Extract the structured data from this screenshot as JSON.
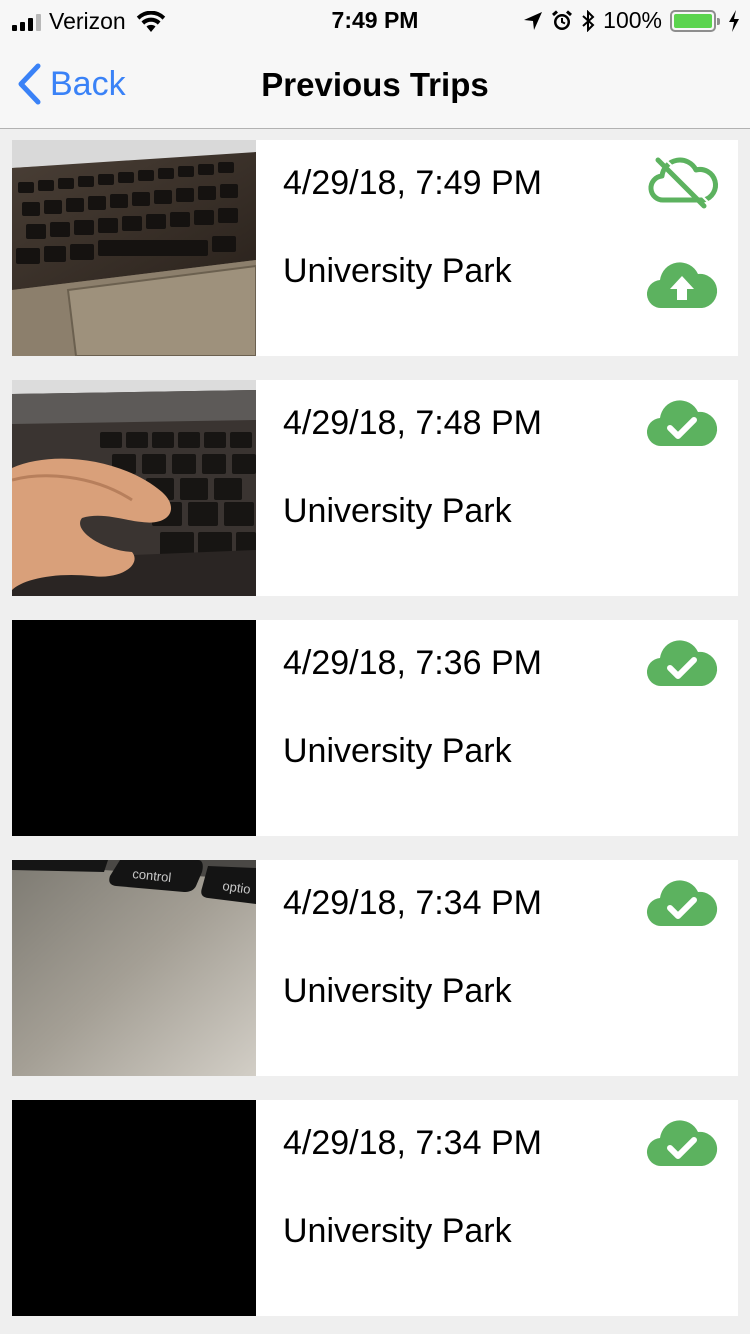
{
  "status_bar": {
    "carrier": "Verizon",
    "time": "7:49 PM",
    "battery_percent": "100%",
    "battery_level": 1.0,
    "signal_bars": 3,
    "icons": [
      "signal-icon",
      "wifi-icon",
      "location-arrow-icon",
      "alarm-icon",
      "bluetooth-icon",
      "battery-icon",
      "charging-bolt-icon"
    ]
  },
  "nav": {
    "back_label": "Back",
    "title": "Previous Trips"
  },
  "colors": {
    "accent": "#3a82f7",
    "cloud_green": "#5cb25f",
    "battery_green": "#5bd44e"
  },
  "trips": [
    {
      "date": "4/29/18, 7:49 PM",
      "place": "University Park",
      "status_icon": "cloud-off-icon",
      "action_icon": "cloud-upload-icon",
      "thumbnail": "keyboard-trackpad-photo"
    },
    {
      "date": "4/29/18, 7:48 PM",
      "place": "University Park",
      "status_icon": "cloud-check-icon",
      "thumbnail": "hand-on-keyboard-photo"
    },
    {
      "date": "4/29/18, 7:36 PM",
      "place": "University Park",
      "status_icon": "cloud-check-icon",
      "thumbnail": "black-photo"
    },
    {
      "date": "4/29/18, 7:34 PM",
      "place": "University Park",
      "status_icon": "cloud-check-icon",
      "thumbnail": "laptop-control-key-photo"
    },
    {
      "date": "4/29/18, 7:34 PM",
      "place": "University Park",
      "status_icon": "cloud-check-icon",
      "thumbnail": "black-photo"
    }
  ],
  "thumbnail_text": {
    "control_key": "control",
    "option_key": "optio"
  }
}
